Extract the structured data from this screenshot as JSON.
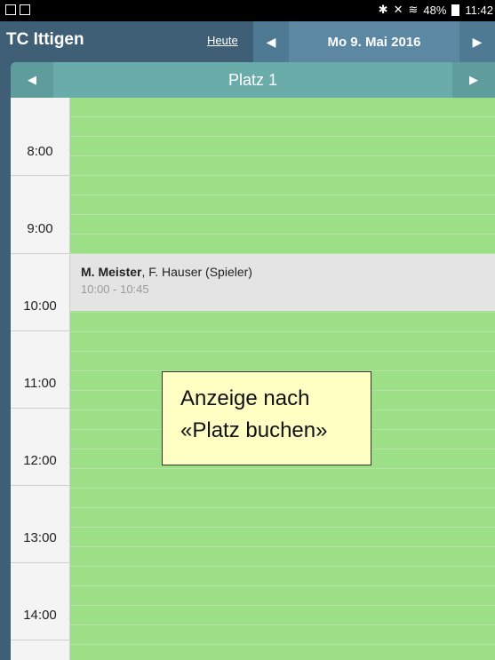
{
  "statusbar": {
    "status_text": "48%",
    "time": "11:42"
  },
  "header": {
    "app_title": "TC Ittigen",
    "today_label": "Heute",
    "date_label": "Mo 9. Mai 2016",
    "prev_icon": "◀",
    "next_icon": "▶"
  },
  "court": {
    "name": "Platz 1",
    "prev_icon": "◀",
    "next_icon": "▶"
  },
  "schedule": {
    "hours": [
      "8:00",
      "9:00",
      "10:00",
      "11:00",
      "12:00",
      "13:00",
      "14:00"
    ],
    "free_color": "#9ddf87",
    "booked_color": "#e4e4e4"
  },
  "booking": {
    "main_player": "M. Meister",
    "other_players": ", F. Hauser (Spieler)",
    "time_range": "10:00 - 10:45"
  },
  "note": {
    "line1": "Anzeige nach",
    "line2": "«Platz buchen»"
  }
}
